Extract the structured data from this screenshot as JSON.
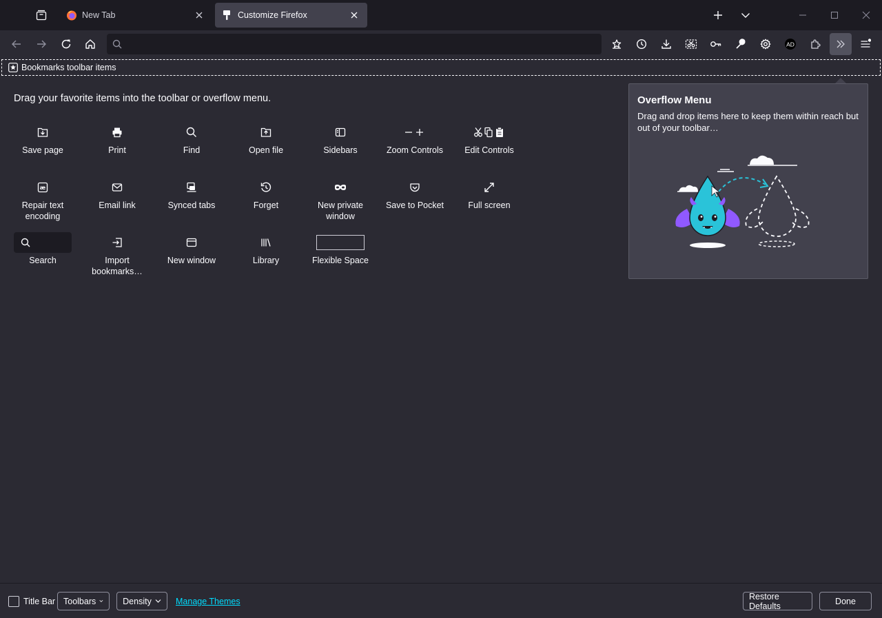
{
  "tabs": [
    {
      "label": "New Tab",
      "icon": "firefox-logo-icon",
      "selected": false
    },
    {
      "label": "Customize Firefox",
      "icon": "customize-brush-icon",
      "selected": true
    }
  ],
  "toolbar": {
    "url_placeholder": "",
    "icons": [
      "back-icon",
      "forward-icon",
      "reload-icon",
      "home-icon",
      "bookmark-star-icon",
      "history-icon",
      "downloads-icon",
      "screenshot-icon",
      "passwords-key-icon",
      "developer-wrench-icon",
      "settings-gear-icon",
      "account-avatar-icon",
      "extensions-icon",
      "overflow-chevrons-icon",
      "app-menu-icon"
    ]
  },
  "bookmarks_toolbar": {
    "label": "Bookmarks toolbar items"
  },
  "palette": {
    "heading": "Drag your favorite items into the toolbar or overflow menu.",
    "items": [
      {
        "label": "Save page"
      },
      {
        "label": "Print"
      },
      {
        "label": "Find"
      },
      {
        "label": "Open file"
      },
      {
        "label": "Sidebars"
      },
      {
        "label": "Zoom Controls"
      },
      {
        "label": "Edit Controls"
      },
      {
        "label": "Repair text encoding"
      },
      {
        "label": "Email link"
      },
      {
        "label": "Synced tabs"
      },
      {
        "label": "Forget"
      },
      {
        "label": "New private window"
      },
      {
        "label": "Save to Pocket"
      },
      {
        "label": "Full screen"
      },
      {
        "label": "Search"
      },
      {
        "label": "Import bookmarks…"
      },
      {
        "label": "New window"
      },
      {
        "label": "Library"
      },
      {
        "label": "Flexible Space"
      }
    ]
  },
  "overflow_panel": {
    "title": "Overflow Menu",
    "description": "Drag and drop items here to keep them within reach but out of your toolbar…"
  },
  "footer": {
    "title_bar_label": "Title Bar",
    "title_bar_checked": false,
    "toolbars_label": "Toolbars",
    "density_label": "Density",
    "manage_themes": "Manage Themes",
    "restore_defaults": "Restore Defaults",
    "done": "Done"
  },
  "colors": {
    "background": "#2b2a33",
    "tabstrip": "#1c1b22",
    "selected_tab": "#42414d",
    "link": "#00ddff",
    "illustration_teal": "#2ac3a2",
    "illustration_purple": "#9059ff"
  }
}
